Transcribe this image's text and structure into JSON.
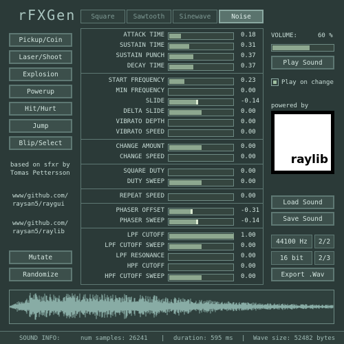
{
  "title": "rFXGen",
  "tabs": [
    "Square",
    "Sawtooth",
    "Sinewave",
    "Noise"
  ],
  "left_buttons": [
    "Pickup/Coin",
    "Laser/Shoot",
    "Explosion",
    "Powerup",
    "Hit/Hurt",
    "Jump",
    "Blip/Select"
  ],
  "credits": {
    "line1": "based on sfxr by",
    "line2": "Tomas Pettersson",
    "gui1": "www/github.com/",
    "gui2": "raysan5/raygui",
    "lib1": "www/github.com/",
    "lib2": "raysan5/raylib"
  },
  "bottom_buttons": {
    "mutate": "Mutate",
    "randomize": "Randomize"
  },
  "sliders": [
    {
      "label": "ATTACK TIME",
      "value": "0.18",
      "fill": 0.18
    },
    {
      "label": "SUSTAIN TIME",
      "value": "0.31",
      "fill": 0.31
    },
    {
      "label": "SUSTAIN PUNCH",
      "value": "0.37",
      "fill": 0.37
    },
    {
      "label": "DECAY TIME",
      "value": "0.37",
      "fill": 0.37
    },
    {
      "label": "START FREQUENCY",
      "value": "0.23",
      "fill": 0.23
    },
    {
      "label": "MIN FREQUENCY",
      "value": "0.00",
      "fill": 0
    },
    {
      "label": "SLIDE",
      "value": "-0.14",
      "fill": -0.14,
      "bipolar": true
    },
    {
      "label": "DELTA SLIDE",
      "value": "0.00",
      "fill": 0.5,
      "half": true
    },
    {
      "label": "VIBRATO DEPTH",
      "value": "0.00",
      "fill": 0
    },
    {
      "label": "VIBRATO SPEED",
      "value": "0.00",
      "fill": 0
    },
    {
      "label": "CHANGE AMOUNT",
      "value": "0.00",
      "fill": 0.5,
      "half": true
    },
    {
      "label": "CHANGE SPEED",
      "value": "0.00",
      "fill": 0
    },
    {
      "label": "SQUARE DUTY",
      "value": "0.00",
      "fill": 0
    },
    {
      "label": "DUTY SWEEP",
      "value": "0.00",
      "fill": 0.5,
      "half": true
    },
    {
      "label": "REPEAT SPEED",
      "value": "0.00",
      "fill": 0
    },
    {
      "label": "PHASER OFFSET",
      "value": "-0.31",
      "fill": -0.31,
      "bipolar": true
    },
    {
      "label": "PHASER SWEEP",
      "value": "-0.14",
      "fill": -0.14,
      "bipolar": true
    },
    {
      "label": "LPF CUTOFF",
      "value": "1.00",
      "fill": 1
    },
    {
      "label": "LPF CUTOFF SWEEP",
      "value": "0.00",
      "fill": 0.5,
      "half": true
    },
    {
      "label": "LPF RESONANCE",
      "value": "0.00",
      "fill": 0
    },
    {
      "label": "HPF CUTOFF",
      "value": "0.00",
      "fill": 0
    },
    {
      "label": "HPF CUTOFF SWEEP",
      "value": "0.00",
      "fill": 0.5,
      "half": true
    }
  ],
  "right": {
    "volume_label": "VOLUME:",
    "volume_value": "60 %",
    "volume_fill": 0.6,
    "play_sound": "Play Sound",
    "play_on_change": "Play on change",
    "powered_by": "powered by",
    "raylib": "raylib",
    "load_sound": "Load Sound",
    "save_sound": "Save Sound",
    "sample_rate": "44100 Hz",
    "sample_rate_toggle": "2/2",
    "bits": "16 bit",
    "bits_toggle": "2/3",
    "export": "Export .Wav"
  },
  "status": {
    "label": "SOUND INFO:",
    "samples": "num samples: 26241",
    "duration": "duration: 595 ms",
    "size": "Wave size: 52482 bytes"
  },
  "colors": {
    "background": "#2b3a38",
    "accent": "#8ea890",
    "wave": "#9fc7c0"
  }
}
